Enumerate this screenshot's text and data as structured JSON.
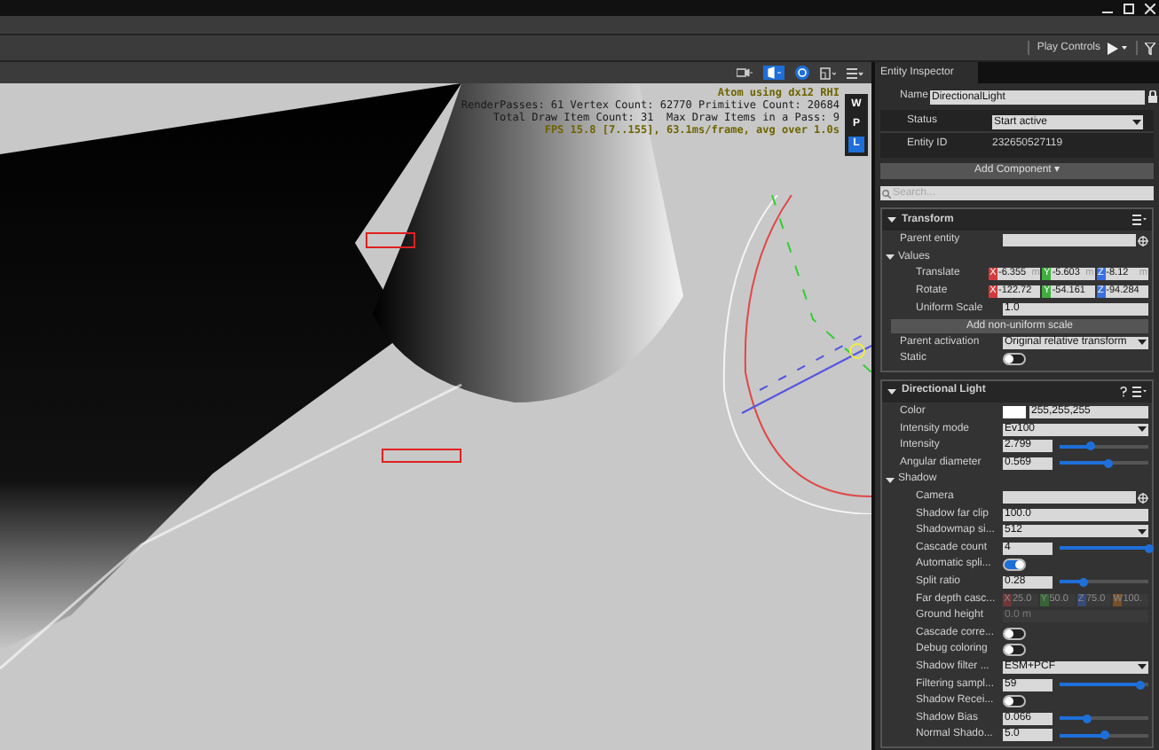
{
  "toolbar": {
    "play_controls": "Play Controls"
  },
  "viewport": {
    "overlay_lines": [
      {
        "text": "Atom using dx12 RHI",
        "kind": "highlight"
      },
      {
        "text": "RenderPasses: 61 Vertex Count: 62770 Primitive Count: 20684",
        "kind": "plain"
      },
      {
        "text": "Total Draw Item Count: 31  Max Draw Items in a Pass: 9",
        "kind": "plain"
      },
      {
        "text": "FPS 15.8 [7..155], 63.1ms/frame, avg over 1.0s",
        "kind": "highlight"
      }
    ],
    "side_buttons": [
      {
        "label": "W",
        "selected": false
      },
      {
        "label": "P",
        "selected": false
      },
      {
        "label": "L",
        "selected": true
      }
    ]
  },
  "inspector": {
    "tab": "Entity Inspector",
    "name_label": "Name",
    "name_value": "DirectionalLight",
    "status_label": "Status",
    "status_value": "Start active",
    "id_label": "Entity ID",
    "id_value": "232650527119",
    "add_component": "Add Component ▾",
    "search_placeholder": "Search...",
    "components": [
      {
        "title": "Transform",
        "expanded": true,
        "help": false,
        "rows": [
          {
            "kind": "entity",
            "label": "Parent entity"
          },
          {
            "kind": "group",
            "label": "Values",
            "expanded": true,
            "children": [
              {
                "kind": "vector",
                "label": "Translate",
                "values": [
                  {
                    "axis": "X",
                    "value": "-6.355",
                    "unit": "m"
                  },
                  {
                    "axis": "Y",
                    "value": "-5.603",
                    "unit": "m"
                  },
                  {
                    "axis": "Z",
                    "value": "-8.12",
                    "unit": "m"
                  }
                ],
                "disabled": false
              },
              {
                "kind": "vector",
                "label": "Rotate",
                "values": [
                  {
                    "axis": "X",
                    "value": "-122.72"
                  },
                  {
                    "axis": "Y",
                    "value": "-54.161"
                  },
                  {
                    "axis": "Z",
                    "value": "-94.284"
                  }
                ],
                "disabled": false
              },
              {
                "kind": "text",
                "label": "Uniform Scale",
                "value": "1.0",
                "disabled": false
              }
            ]
          },
          {
            "kind": "button",
            "label": "Add non-uniform scale"
          },
          {
            "kind": "dropdown",
            "label": "Parent activation",
            "value": "Original relative transform"
          },
          {
            "kind": "toggle",
            "label": "Static",
            "on": false
          }
        ]
      },
      {
        "title": "Directional Light",
        "expanded": true,
        "help": true,
        "rows": [
          {
            "kind": "color",
            "label": "Color",
            "value": "255,255,255",
            "color": "#ffffff"
          },
          {
            "kind": "dropdown",
            "label": "Intensity mode",
            "value": "Ev100"
          },
          {
            "kind": "slider",
            "label": "Intensity",
            "value": "2.799",
            "level": 0.35
          },
          {
            "kind": "slider",
            "label": "Angular diameter",
            "value": "0.569",
            "level": 0.55
          },
          {
            "kind": "group",
            "label": "Shadow",
            "expanded": true,
            "children": [
              {
                "kind": "entity",
                "label": "Camera"
              },
              {
                "kind": "text",
                "label": "Shadow far clip",
                "value": "100.0",
                "disabled": false
              },
              {
                "kind": "dropdown",
                "label": "Shadowmap si...",
                "value": "512"
              },
              {
                "kind": "slider",
                "label": "Cascade count",
                "value": "4",
                "level": 1.0
              },
              {
                "kind": "toggle",
                "label": "Automatic spli...",
                "on": true
              },
              {
                "kind": "slider",
                "label": "Split ratio",
                "value": "0.28",
                "level": 0.27
              },
              {
                "kind": "vector",
                "label": "Far depth casc...",
                "values": [
                  {
                    "axis": "X",
                    "value": "25.0"
                  },
                  {
                    "axis": "Y",
                    "value": "50.0"
                  },
                  {
                    "axis": "Z",
                    "value": "75.0"
                  },
                  {
                    "axis": "W",
                    "value": "100."
                  }
                ],
                "disabled": true
              },
              {
                "kind": "text",
                "label": "Ground height",
                "value": "0.0 m",
                "disabled": true
              },
              {
                "kind": "toggle",
                "label": "Cascade corre...",
                "on": false
              },
              {
                "kind": "toggle",
                "label": "Debug coloring",
                "on": false
              },
              {
                "kind": "dropdown",
                "label": "Shadow filter ...",
                "value": "ESM+PCF"
              },
              {
                "kind": "slider",
                "label": "Filtering sampl...",
                "value": "59",
                "level": 0.9
              },
              {
                "kind": "toggle",
                "label": "Shadow Recei...",
                "on": false
              },
              {
                "kind": "slider",
                "label": "Shadow Bias",
                "value": "0.066",
                "level": 0.3
              },
              {
                "kind": "slider",
                "label": "Normal Shado...",
                "value": "5.0",
                "level": 0.5
              }
            ]
          }
        ]
      }
    ]
  }
}
